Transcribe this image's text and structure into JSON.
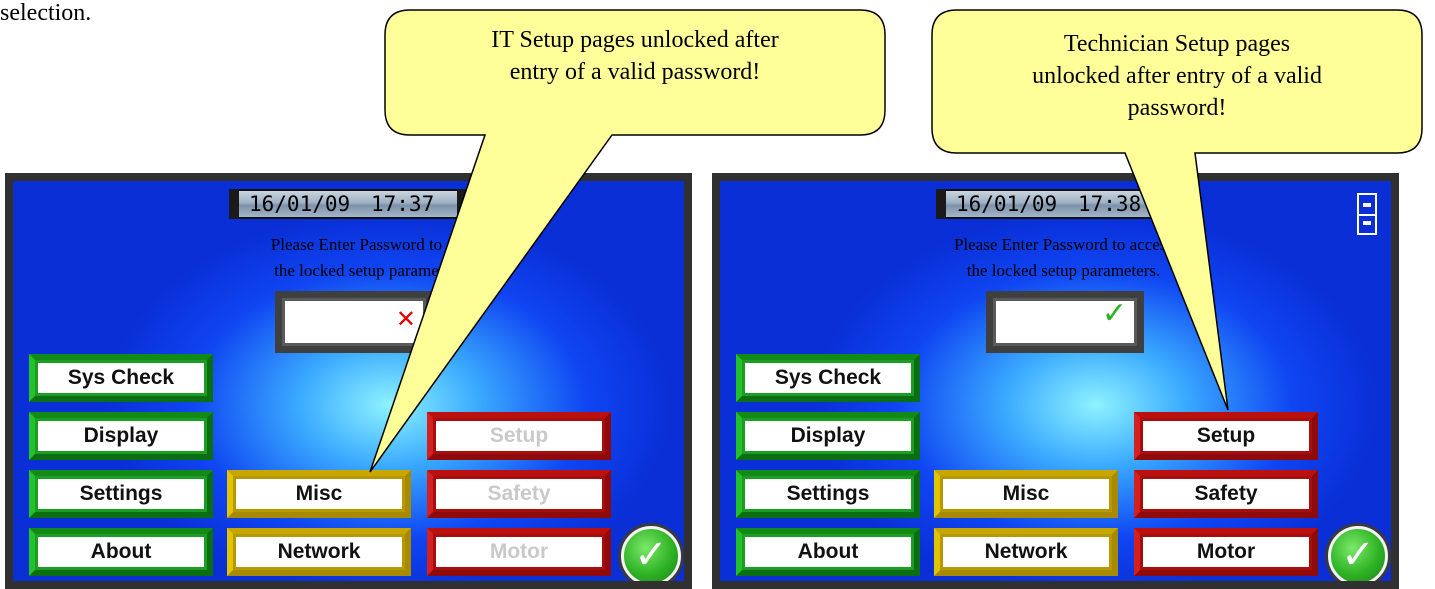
{
  "caption": "selection.",
  "left_panel": {
    "date": "16/01/09",
    "time": "17:37",
    "prompt_line1": "Please Enter Password to",
    "prompt_line2": "the locked setup parame",
    "password_status": "✕",
    "buttons": {
      "sys_check": "Sys Check",
      "display": "Display",
      "settings": "Settings",
      "about": "About",
      "misc": "Misc",
      "network": "Network",
      "setup": "Setup",
      "safety": "Safety",
      "motor": "Motor"
    },
    "ok": "✓"
  },
  "right_panel": {
    "date": "16/01/09",
    "time": "17:38",
    "prompt_line1": "Please Enter Password to access",
    "prompt_line2": "the locked setup parameters.",
    "password_status": "✓",
    "buttons": {
      "sys_check": "Sys Check",
      "display": "Display",
      "settings": "Settings",
      "about": "About",
      "misc": "Misc",
      "network": "Network",
      "setup": "Setup",
      "safety": "Safety",
      "motor": "Motor"
    },
    "ok": "✓"
  },
  "callouts": {
    "it_line1": "IT Setup pages unlocked after",
    "it_line2": "entry of a valid password!",
    "tech_line1": "Technician Setup pages",
    "tech_line2": "unlocked after entry of a valid",
    "tech_line3": "password!"
  },
  "colors": {
    "panel_blue": "#0f45f2",
    "button_green": "#1c9e24",
    "button_yellow": "#b89800",
    "button_red": "#a80e0e",
    "callout_fill": "#ffff99"
  }
}
